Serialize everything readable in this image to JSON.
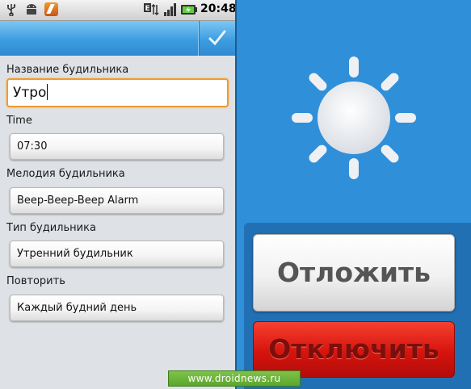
{
  "status_bar": {
    "time": "20:48",
    "icons": [
      "usb-icon",
      "android-icon",
      "app-notification-icon",
      "data-edge-icon",
      "signal-icon",
      "battery-charging-icon"
    ]
  },
  "action_bar": {
    "done_icon": "checkmark-icon"
  },
  "form": {
    "name_label": "Название будильника",
    "name_value": "Утро",
    "time_label": "Time",
    "time_value": "07:30",
    "melody_label": "Мелодия будильника",
    "melody_value": "Beep-Beep-Beep Alarm",
    "type_label": "Тип будильника",
    "type_value": "Утренний будильник",
    "repeat_label": "Повторить",
    "repeat_value": "Каждый будний день"
  },
  "alarm_screen": {
    "icon": "sun-icon",
    "snooze_label": "Отложить",
    "dismiss_label": "Отключить"
  },
  "watermark": "www.droidnews.ru",
  "colors": {
    "accent_orange": "#f19a2e",
    "action_bar_blue": "#3d9de0",
    "alarm_background": "#2f8fd9",
    "dismiss_red": "#d6140e"
  }
}
